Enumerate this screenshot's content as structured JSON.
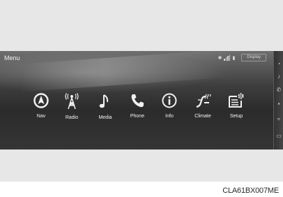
{
  "screen": {
    "title": "Menu",
    "display_button": "Display"
  },
  "menu_items": [
    {
      "label": "Nav",
      "icon": "nav-icon"
    },
    {
      "label": "Radio",
      "icon": "radio-tower-icon"
    },
    {
      "label": "Media",
      "icon": "music-note-icon"
    },
    {
      "label": "Phone",
      "icon": "phone-icon"
    },
    {
      "label": "Info",
      "icon": "info-icon"
    },
    {
      "label": "Climate",
      "icon": "climate-icon"
    },
    {
      "label": "Setup",
      "icon": "setup-icon"
    }
  ],
  "figure": {
    "code": "CLA61BX007ME"
  },
  "colors": {
    "screen_bg": "#2b2b2b",
    "label_text": "#f4f4f4",
    "page_band": "#e7e7e7"
  }
}
